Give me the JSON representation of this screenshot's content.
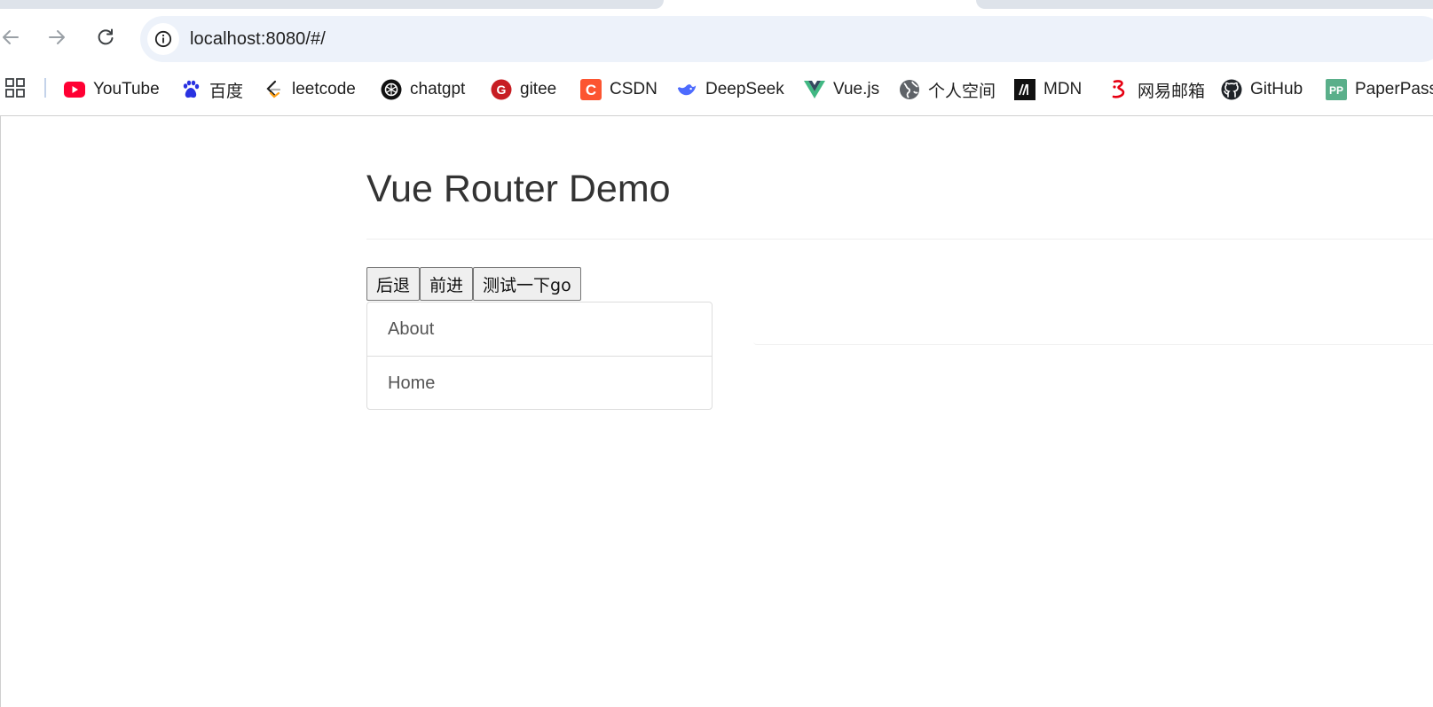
{
  "browser": {
    "address": "localhost:8080/#/",
    "colors": {
      "omnibox_bg": "#edf2fa",
      "tab_inactive": "#dee3ea"
    }
  },
  "bookmarks": [
    {
      "label": "YouTube",
      "icon": "youtube-icon"
    },
    {
      "label": "百度",
      "icon": "baidu-icon"
    },
    {
      "label": "leetcode",
      "icon": "leetcode-icon"
    },
    {
      "label": "chatgpt",
      "icon": "chatgpt-icon"
    },
    {
      "label": "gitee",
      "icon": "gitee-icon"
    },
    {
      "label": "CSDN",
      "icon": "csdn-icon"
    },
    {
      "label": "DeepSeek",
      "icon": "deepseek-icon"
    },
    {
      "label": "Vue.js",
      "icon": "vue-icon"
    },
    {
      "label": "个人空间",
      "icon": "globe-icon"
    },
    {
      "label": "MDN",
      "icon": "mdn-icon"
    },
    {
      "label": "网易邮箱",
      "icon": "netease-mail-icon"
    },
    {
      "label": "GitHub",
      "icon": "github-icon"
    },
    {
      "label": "PaperPass",
      "icon": "paperpass-icon"
    }
  ],
  "page": {
    "title": "Vue Router Demo",
    "buttons": {
      "back": "后退",
      "forward": "前进",
      "go_test": "测试一下go"
    },
    "nav_links": [
      {
        "label": "About"
      },
      {
        "label": "Home"
      }
    ]
  }
}
